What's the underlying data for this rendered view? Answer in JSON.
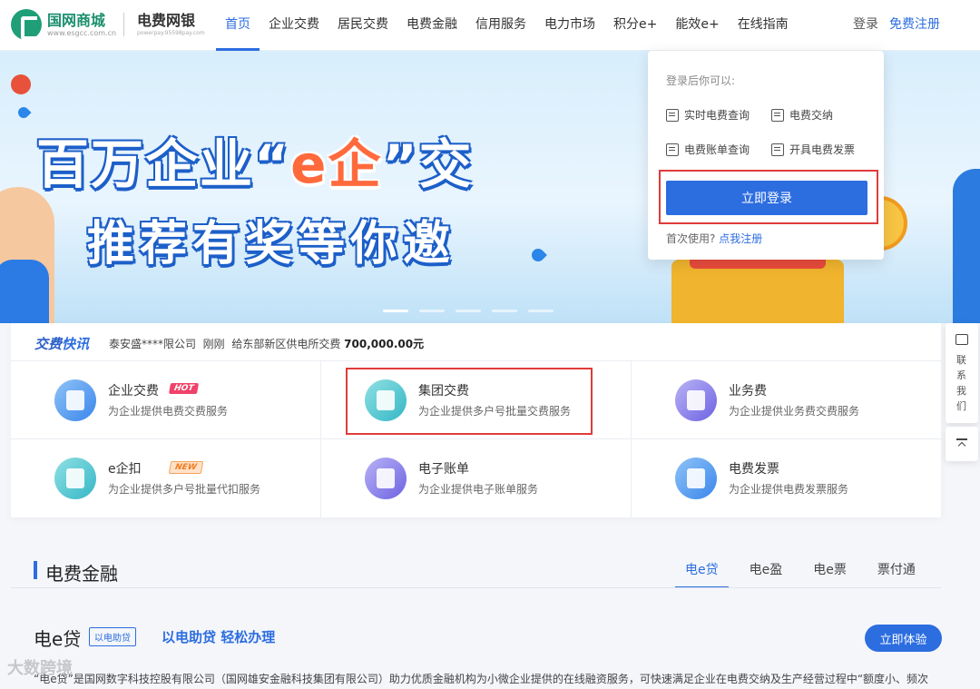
{
  "header": {
    "logo_name": "国网商城",
    "logo_url": "www.esgcc.com.cn",
    "product_name": "电费网银",
    "product_sub": "powerpay.95598pay.com",
    "nav": [
      {
        "label": "首页",
        "active": true
      },
      {
        "label": "企业交费"
      },
      {
        "label": "居民交费"
      },
      {
        "label": "电费金融"
      },
      {
        "label": "信用服务"
      },
      {
        "label": "电力市场"
      },
      {
        "label": "积分e+"
      },
      {
        "label": "能效e+"
      },
      {
        "label": "在线指南"
      }
    ],
    "login": "登录",
    "register": "免费注册"
  },
  "banner": {
    "line1_pre": "百万企业“",
    "line1_hl": "e企",
    "line1_post": "”交",
    "line2": "推荐有奖等你邀"
  },
  "login_popup": {
    "hint": "登录后你可以:",
    "features": [
      "实时电费查询",
      "电费交纳",
      "电费账单查询",
      "开具电费发票"
    ],
    "button": "立即登录",
    "first_use": "首次使用?",
    "register_link": "点我注册"
  },
  "ticker": {
    "title_a": "交费",
    "title_b": "快讯",
    "company": "泰安盛****限公司",
    "time": "刚刚",
    "action": "给东部新区供电所交费",
    "amount": "700,000.00元"
  },
  "services": [
    {
      "name": "企业交费",
      "desc": "为企业提供电费交费服务",
      "badge": "HOT"
    },
    {
      "name": "集团交费",
      "desc": "为企业提供多户号批量交费服务"
    },
    {
      "name": "业务费",
      "desc": "为企业提供业务费交费服务"
    },
    {
      "name": "e企扣",
      "desc": "为企业提供多户号批量代扣服务",
      "badge": "NEW"
    },
    {
      "name": "电子账单",
      "desc": "为企业提供电子账单服务"
    },
    {
      "name": "电费发票",
      "desc": "为企业提供电费发票服务"
    }
  ],
  "finance": {
    "title": "电费金融",
    "tabs": [
      "电e贷",
      "电e盈",
      "电e票",
      "票付通"
    ],
    "product_name": "电e贷",
    "product_tag": "以电助贷",
    "slogan": "以电助贷 轻松办理",
    "try_button": "立即体验",
    "description": "“电e贷”是国网数字科技控股有限公司（国网雄安金融科技集团有限公司）助力优质金融机构为小微企业提供的在线融资服务，可快速满足企业在电费交纳及生产经营过程中“额度小、频次"
  },
  "side": {
    "contact": "联系我们"
  },
  "watermark": "大数跨境",
  "colors": {
    "primary": "#2c6de0",
    "highlight_outline": "#e03b3b",
    "brand_green": "#1f9e78"
  }
}
